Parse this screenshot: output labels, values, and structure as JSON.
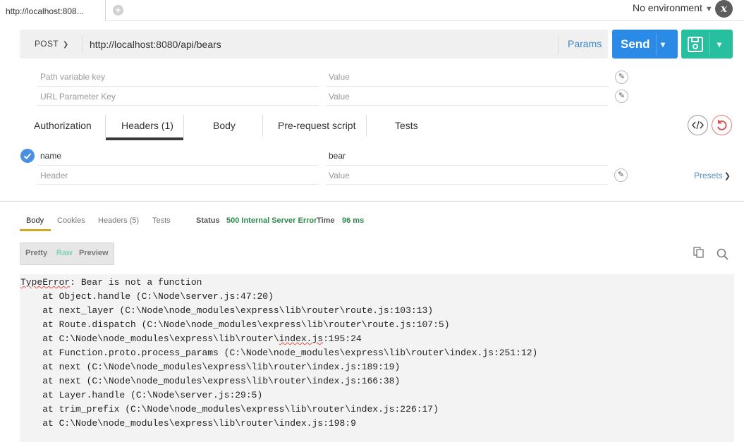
{
  "tabs": {
    "active_label": "http://localhost:808...",
    "add_icon": "plus-icon"
  },
  "environment": {
    "label": "No environment",
    "icon": "chevron-down-icon",
    "manage_icon": "x-icon"
  },
  "request": {
    "method": "POST",
    "url": "http://localhost:8080/api/bears",
    "params_label": "Params",
    "send_label": "Send",
    "save_icon": "floppy-disk-icon"
  },
  "url_params": [
    {
      "key_placeholder": "Path variable key",
      "value_placeholder": "Value"
    },
    {
      "key_placeholder": "URL Parameter Key",
      "value_placeholder": "Value"
    }
  ],
  "request_tabs": [
    "Authorization",
    "Headers (1)",
    "Body",
    "Pre-request script",
    "Tests"
  ],
  "active_request_tab": "Headers (1)",
  "headers": {
    "rows": [
      {
        "key": "name",
        "value": "bear",
        "enabled": true
      }
    ],
    "new_key_placeholder": "Header",
    "new_value_placeholder": "Value",
    "presets_label": "Presets"
  },
  "response": {
    "tabs": [
      "Body",
      "Cookies",
      "Headers (5)",
      "Tests"
    ],
    "active_tab": "Body",
    "status_label": "Status",
    "status_value": "500 Internal Server Error",
    "time_label": "Time",
    "time_value": "96 ms",
    "formats": [
      "Pretty",
      "Raw",
      "Preview"
    ],
    "active_format": "Raw",
    "body_lines": [
      "TypeError: Bear is not a function",
      "    at Object.handle (C:\\Node\\server.js:47:20)",
      "    at next_layer (C:\\Node\\node_modules\\express\\lib\\router\\route.js:103:13)",
      "    at Route.dispatch (C:\\Node\\node_modules\\express\\lib\\router\\route.js:107:5)",
      "    at C:\\Node\\node_modules\\express\\lib\\router\\index.js:195:24",
      "    at Function.proto.process_params (C:\\Node\\node_modules\\express\\lib\\router\\index.js:251:12)",
      "    at next (C:\\Node\\node_modules\\express\\lib\\router\\index.js:189:19)",
      "    at next (C:\\Node\\node_modules\\express\\lib\\router\\index.js:166:38)",
      "    at Layer.handle (C:\\Node\\server.js:29:5)",
      "    at trim_prefix (C:\\Node\\node_modules\\express\\lib\\router\\index.js:226:17)",
      "    at C:\\Node\\node_modules\\express\\lib\\router\\index.js:198:9"
    ]
  },
  "colors": {
    "send": "#2a8ae6",
    "save": "#26c0a1",
    "status_ok_text": "#2d8a4d",
    "active_tab_underline": "#d4a824"
  }
}
